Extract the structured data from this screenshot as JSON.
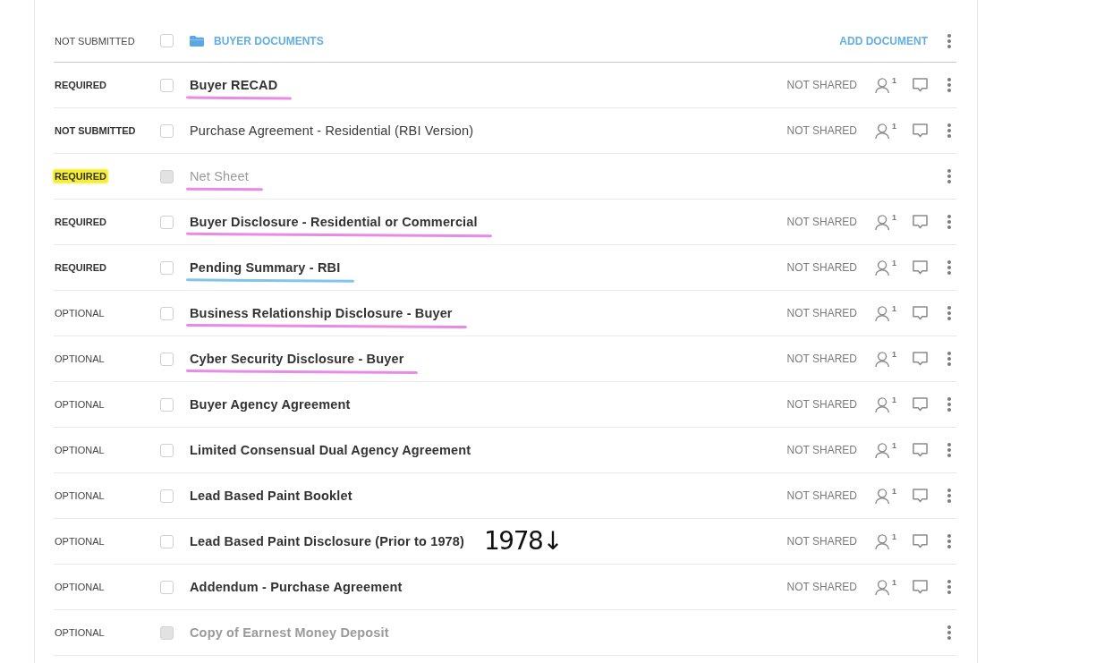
{
  "folder": {
    "status": "NOT SUBMITTED",
    "checked": false,
    "name": "BUYER DOCUMENTS",
    "action": "ADD DOCUMENT"
  },
  "documents": [
    {
      "status": "REQUIRED",
      "status_bold": true,
      "status_highlighted": false,
      "checked": false,
      "disabled": false,
      "title": "Buyer RECAD",
      "title_bold": true,
      "underline": {
        "color": "#e98ae8"
      },
      "sharing": "NOT SHARED",
      "assignees": "1"
    },
    {
      "status": "NOT SUBMITTED",
      "status_bold": true,
      "status_highlighted": false,
      "checked": false,
      "disabled": false,
      "title": "Purchase Agreement - Residential (RBI Version)",
      "title_bold": false,
      "sharing": "NOT SHARED",
      "assignees": "1"
    },
    {
      "status": "REQUIRED",
      "status_bold": true,
      "status_highlighted": true,
      "checked": false,
      "disabled": true,
      "title": "Net Sheet",
      "title_bold": false,
      "underline": {
        "color": "#e98ae8"
      }
    },
    {
      "status": "REQUIRED",
      "status_bold": true,
      "status_highlighted": false,
      "checked": false,
      "disabled": false,
      "title": "Buyer Disclosure - Residential or Commercial",
      "title_bold": true,
      "underline": {
        "color": "#e98ae8"
      },
      "sharing": "NOT SHARED",
      "assignees": "1"
    },
    {
      "status": "REQUIRED",
      "status_bold": true,
      "status_highlighted": false,
      "checked": false,
      "disabled": false,
      "title": "Pending Summary - RBI",
      "title_bold": true,
      "underline": {
        "color": "#80c6ea"
      },
      "sharing": "NOT SHARED",
      "assignees": "1"
    },
    {
      "status": "OPTIONAL",
      "status_bold": false,
      "status_highlighted": false,
      "checked": false,
      "disabled": false,
      "title": "Business Relationship Disclosure - Buyer",
      "title_bold": true,
      "underline": {
        "color": "#e98ae8"
      },
      "sharing": "NOT SHARED",
      "assignees": "1"
    },
    {
      "status": "OPTIONAL",
      "status_bold": false,
      "status_highlighted": false,
      "checked": false,
      "disabled": false,
      "title": "Cyber Security Disclosure - Buyer",
      "title_bold": true,
      "underline": {
        "color": "#e98ae8"
      },
      "sharing": "NOT SHARED",
      "assignees": "1"
    },
    {
      "status": "OPTIONAL",
      "status_bold": false,
      "status_highlighted": false,
      "checked": false,
      "disabled": false,
      "title": "Buyer Agency Agreement",
      "title_bold": true,
      "sharing": "NOT SHARED",
      "assignees": "1"
    },
    {
      "status": "OPTIONAL",
      "status_bold": false,
      "status_highlighted": false,
      "checked": false,
      "disabled": false,
      "title": "Limited Consensual Dual Agency Agreement",
      "title_bold": true,
      "sharing": "NOT SHARED",
      "assignees": "1"
    },
    {
      "status": "OPTIONAL",
      "status_bold": false,
      "status_highlighted": false,
      "checked": false,
      "disabled": false,
      "title": "Lead Based Paint Booklet",
      "title_bold": true,
      "sharing": "NOT SHARED",
      "assignees": "1"
    },
    {
      "status": "OPTIONAL",
      "status_bold": false,
      "status_highlighted": false,
      "checked": false,
      "disabled": false,
      "title": "Lead Based Paint Disclosure (Prior to 1978)",
      "title_bold": true,
      "note": "1978↓",
      "sharing": "NOT SHARED",
      "assignees": "1"
    },
    {
      "status": "OPTIONAL",
      "status_bold": false,
      "status_highlighted": false,
      "checked": false,
      "disabled": false,
      "title": "Addendum - Purchase Agreement",
      "title_bold": true,
      "sharing": "NOT SHARED",
      "assignees": "1"
    },
    {
      "status": "OPTIONAL",
      "status_bold": false,
      "status_highlighted": false,
      "checked": false,
      "disabled": true,
      "title": "Copy of Earnest Money Deposit",
      "title_bold": true
    }
  ]
}
